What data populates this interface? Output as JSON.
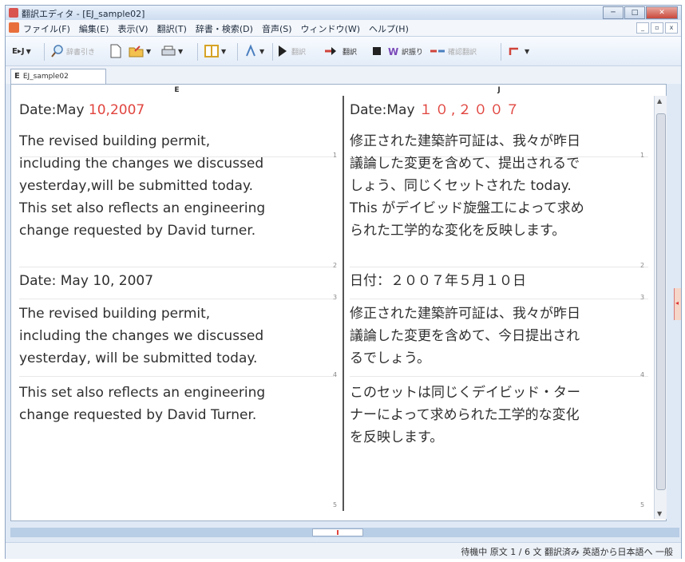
{
  "window": {
    "title": "翻訳エディタ - [EJ_sample02]",
    "controls": [
      "─",
      "□",
      "✕"
    ]
  },
  "menubar": {
    "items": [
      "ファイル(F)",
      "編集(E)",
      "表示(V)",
      "翻訳(T)",
      "辞書・検索(D)",
      "音声(S)",
      "ウィンドウ(W)",
      "ヘルプ(H)"
    ],
    "mdi_controls": [
      "_",
      "▫",
      "x"
    ]
  },
  "toolbar": {
    "direction": "E▸J",
    "dict_label": "辞書引き",
    "translate_label": "翻訳",
    "translate_all_label": "翻訳",
    "reverse_label": "訳振り",
    "back_translate_label": "確認翻訳"
  },
  "tab": {
    "icon_letter": "E",
    "label": "EJ_sample02"
  },
  "editor": {
    "left_header": "E",
    "right_header": "J",
    "segments": [
      {
        "num": "1",
        "en_lines": [
          {
            "a": "Date:May ",
            "b": "10,2007"
          }
        ],
        "ja_lines": [
          {
            "a": "Date:May ",
            "b": "１０,２００７"
          }
        ]
      },
      {
        "num": "2",
        "en_lines": [
          {
            "a": "The revised building permit,"
          },
          {
            "a": "including the changes we discussed"
          },
          {
            "a": "yesterday,will be submitted today."
          },
          {
            "a": "This set also reflects an engineering"
          },
          {
            "a": "change requested by David turner."
          }
        ],
        "ja_lines": [
          {
            "a": "修正された建築許可証は、我々が昨日"
          },
          {
            "a": "議論した変更を含めて、提出されるで"
          },
          {
            "a": "しょう、同じくセットされた today."
          },
          {
            "a": "This がデイビッド旋盤工によって求め"
          },
          {
            "a": "られた工学的な変化を反映します。"
          }
        ]
      },
      {
        "num": "3",
        "en_lines": [
          {
            "a": "Date: May 10, 2007"
          }
        ],
        "ja_lines": [
          {
            "a": "日付：２００７年５月１０日"
          }
        ]
      },
      {
        "num": "4",
        "en_lines": [
          {
            "a": "The revised building permit,"
          },
          {
            "a": "including the changes we discussed"
          },
          {
            "a": "yesterday, will be submitted today."
          }
        ],
        "ja_lines": [
          {
            "a": "修正された建築許可証は、我々が昨日"
          },
          {
            "a": "議論した変更を含めて、今日提出され"
          },
          {
            "a": "るでしょう。"
          }
        ]
      },
      {
        "num": "5",
        "en_lines": [
          {
            "a": "This set also reflects an engineering"
          },
          {
            "a": "change requested by David Turner."
          }
        ],
        "ja_lines": [
          {
            "a": "このセットは同じくデイビッド・ター"
          },
          {
            "a": "ナーによって求められた工学的な変化"
          },
          {
            "a": "を反映します。"
          }
        ]
      }
    ]
  },
  "statusbar": {
    "text": "待機中  原文  1 / 6 文  翻訳済み  英語から日本語へ  一般"
  },
  "colors": {
    "accent_red": "#e0443e",
    "window_frame": "#8fa6c4"
  }
}
